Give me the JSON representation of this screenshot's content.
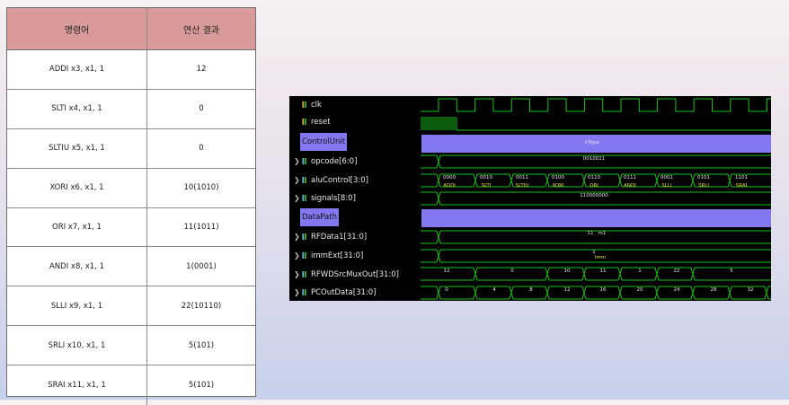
{
  "table": {
    "headers": [
      "명령어",
      "연산 결과"
    ],
    "rows": [
      [
        "ADDI x3, x1, 1",
        "12"
      ],
      [
        "SLTI x4, x1, 1",
        "0"
      ],
      [
        "SLTIU x5, x1, 1",
        "0"
      ],
      [
        "XORI x6, x1, 1",
        "10(1010)"
      ],
      [
        "ORI x7, x1, 1",
        "11(1011)"
      ],
      [
        "ANDI x8, x1, 1",
        "1(0001)"
      ],
      [
        "SLLI x9, x1, 1",
        "22(10110)"
      ],
      [
        "SRLI x10, x1, 1",
        "5(101)"
      ],
      [
        "SRAI x11, x1, 1",
        "5(101)"
      ]
    ]
  },
  "waveform": {
    "signals": [
      "clk",
      "reset",
      "ControlUnit",
      "opcode[6:0]",
      "aluControl[3:0]",
      "signals[8:0]",
      "DataPath",
      "RFData1[31:0]",
      "immExt[31:0]",
      "RFWDSrcMuxOut[31:0]",
      "PCOutData[31:0]"
    ],
    "control_unit_bar": "I-Type",
    "opcode_value": "0010011",
    "alu_control_values": [
      "0000",
      "0010",
      "0011",
      "0100",
      "0110",
      "0111",
      "0001",
      "0101",
      "1101"
    ],
    "alu_control_names": [
      "ADDI",
      "SLTI",
      "SLTIU",
      "XORI",
      "ORI",
      "ANDI",
      "SLLI",
      "SRLI",
      "SRAI"
    ],
    "signals_value": "110000000",
    "rfdata1_value": "11",
    "rfdata1_note": "rs1",
    "immext_value": "1",
    "immext_note": "imm",
    "rfwd_values": [
      "12",
      "0",
      "10",
      "11",
      "1",
      "22",
      "5"
    ],
    "pc_values": [
      "0",
      "4",
      "8",
      "12",
      "16",
      "20",
      "24",
      "28",
      "32"
    ]
  },
  "colors": {
    "header_bg": "#d99a9a",
    "wave_green": "#19c419",
    "group_purple": "#8378f0",
    "annotation_yellow": "#f1e24a"
  }
}
